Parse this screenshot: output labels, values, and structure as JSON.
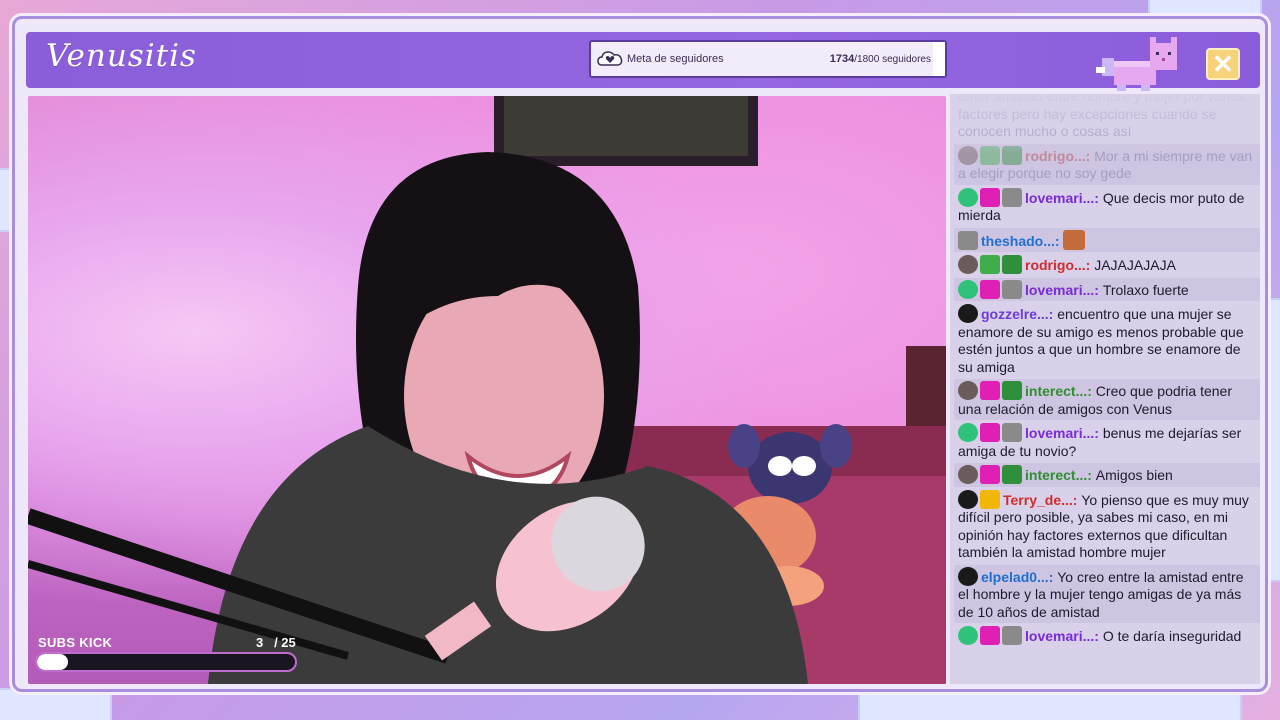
{
  "header": {
    "brand": "Venusitis",
    "close_label": "✕"
  },
  "follower_goal": {
    "label": "Meta de seguidores",
    "current": "1734",
    "target": "/1800 seguidores",
    "progress_fraction": 0.963,
    "icon": "cloud-heart-icon"
  },
  "subs_kick": {
    "label": "SUBS KICK",
    "current": "3",
    "target": "/ 25",
    "progress_fraction": 0.12
  },
  "colors": {
    "header": "#8a5ed9",
    "chat_bg": "#d9d1ea",
    "close_button": "#f6d37a"
  },
  "chat": {
    "messages": [
      {
        "user": "",
        "color": "#a69ec0",
        "text": "tener amistad entre hombre y mujer por varios factores pero hay excepciones cuando se conocen mucho o cosas así",
        "badges": [],
        "faded": true
      },
      {
        "user": "rodrigo...",
        "color": "#c08a9a",
        "text": "Mor a mi siempre me van a elegir porque no soy gede",
        "badges": [
          "avatar",
          "sword",
          "x"
        ],
        "faded": true
      },
      {
        "user": "lovemari...",
        "color": "#7a2bd6",
        "text": "Que decis mor puto de mierda",
        "badges": [
          "person",
          "heart",
          "raccoon"
        ],
        "faded": false
      },
      {
        "user": "theshado...",
        "color": "#1f6fd1",
        "text": "",
        "emote": true,
        "badges": [
          "raccoon"
        ],
        "faded": false
      },
      {
        "user": "rodrigo...",
        "color": "#d12b2b",
        "text": "JAJAJAJAJA",
        "badges": [
          "avatar",
          "sword",
          "x"
        ],
        "faded": false
      },
      {
        "user": "lovemari...",
        "color": "#7a2bd6",
        "text": "Trolaxo fuerte",
        "badges": [
          "person",
          "heart",
          "raccoon"
        ],
        "faded": false
      },
      {
        "user": "gozzelre...",
        "color": "#6d3bd6",
        "text": "encuentro que una mujer se enamore de su amigo es menos probable que estén juntos a que un hombre se enamore de su amiga",
        "badges": [
          "person-dark"
        ],
        "faded": false
      },
      {
        "user": "interect...",
        "color": "#2e8f2e",
        "text": "Creo que podria tener una relación de amigos con Venus",
        "badges": [
          "avatar",
          "heart",
          "x"
        ],
        "faded": false
      },
      {
        "user": "lovemari...",
        "color": "#7a2bd6",
        "text": "benus me dejarías ser amiga de tu novio?",
        "badges": [
          "person",
          "heart",
          "raccoon"
        ],
        "faded": false
      },
      {
        "user": "interect...",
        "color": "#2e8f2e",
        "text": "Amigos bien",
        "badges": [
          "avatar",
          "heart",
          "x"
        ],
        "faded": false
      },
      {
        "user": "Terry_de...",
        "color": "#d12b2b",
        "text": "Yo pienso que es muy muy difícil pero posible, ya sabes mi caso, en mi opinión hay factores externos que dificultan también la amistad hombre mujer",
        "badges": [
          "person-dark",
          "crown"
        ],
        "faded": false
      },
      {
        "user": "elpelad0...",
        "color": "#1f6fd1",
        "text": "Yo creo entre la amistad entre el hombre y la mujer tengo amigas de ya más de 10 años de amistad",
        "badges": [
          "person-dark"
        ],
        "faded": false
      },
      {
        "user": "lovemari...",
        "color": "#7a2bd6",
        "text": "O te daría inseguridad",
        "badges": [
          "person",
          "heart",
          "raccoon"
        ],
        "faded": false
      }
    ]
  }
}
